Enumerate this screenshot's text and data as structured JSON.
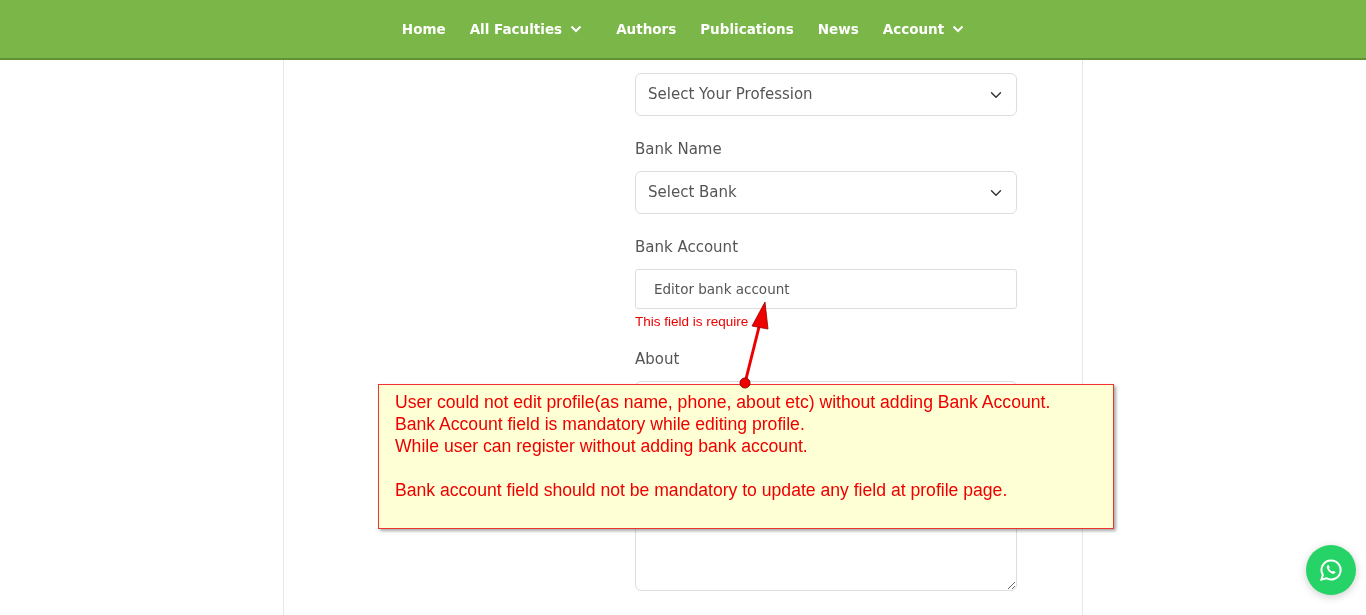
{
  "navbar": {
    "items": [
      {
        "label": "Home",
        "dropdown": false
      },
      {
        "label": "All Faculties",
        "dropdown": true
      },
      {
        "label": "Authors",
        "dropdown": false
      },
      {
        "label": "Publications",
        "dropdown": false
      },
      {
        "label": "News",
        "dropdown": false
      },
      {
        "label": "Account",
        "dropdown": true
      }
    ]
  },
  "form": {
    "fields": [
      {
        "kind": "select",
        "value": "Select Your Profession"
      },
      {
        "kind": "select",
        "label": "Bank Name",
        "value": "Select Bank"
      },
      {
        "kind": "input",
        "label": "Bank Account",
        "placeholder": "Editor bank account",
        "error": "This field is require"
      },
      {
        "kind": "textarea",
        "label": "About"
      }
    ]
  },
  "callout": {
    "paragraphs": [
      [
        "User could not edit profile(as name, phone, about etc) without adding Bank Account.",
        "Bank Account field is mandatory while editing profile.",
        "While user can register without adding bank account."
      ],
      [
        "Bank account field should not be mandatory to update any field at profile page."
      ]
    ]
  }
}
